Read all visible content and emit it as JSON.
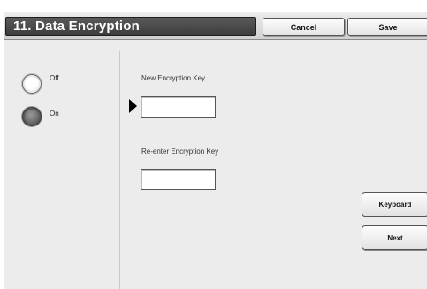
{
  "header": {
    "title": "11. Data Encryption",
    "cancel_label": "Cancel",
    "save_label": "Save"
  },
  "options": [
    {
      "label": "Off",
      "selected": false
    },
    {
      "label": "On",
      "selected": true
    }
  ],
  "fields": {
    "new_key_label": "New Encryption Key",
    "new_key_value": "",
    "reenter_key_label": "Re-enter Encryption Key",
    "reenter_key_value": ""
  },
  "actions": {
    "keyboard_label": "Keyboard",
    "next_label": "Next"
  }
}
